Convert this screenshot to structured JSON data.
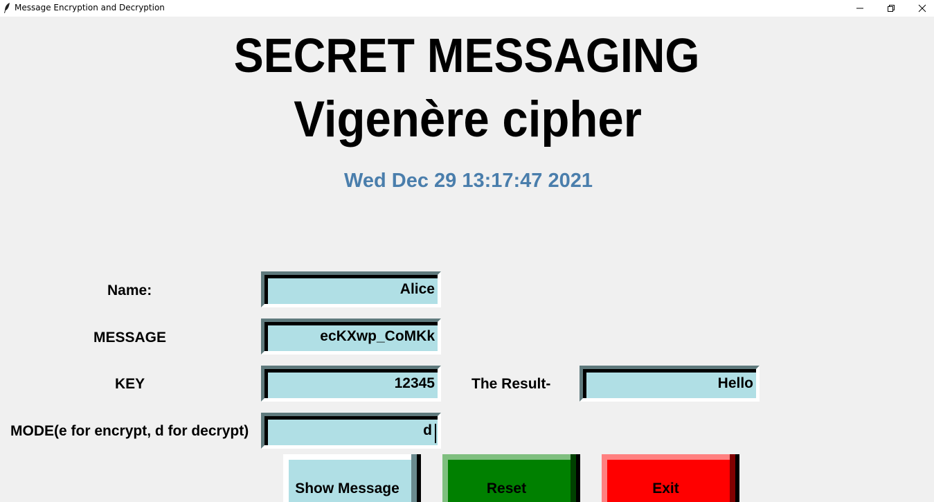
{
  "window": {
    "title": "Message Encryption and Decryption",
    "icon": "feather-icon",
    "controls": [
      "minimize-icon",
      "restore-icon",
      "close-icon"
    ]
  },
  "header": {
    "title": "SECRET MESSAGING",
    "subtitle": "Vigenère cipher",
    "datetime": "Wed Dec 29 13:17:47 2021"
  },
  "form": {
    "name_label": "Name:",
    "name_value": "Alice",
    "message_label": "MESSAGE",
    "message_value": "ecKXwp_CoMKk",
    "key_label": "KEY",
    "key_value": "12345",
    "mode_label": "MODE(e for encrypt, d for decrypt)",
    "mode_value": "d",
    "result_label": "The Result-",
    "result_value": "Hello"
  },
  "buttons": {
    "show_message": "Show Message",
    "reset": "Reset",
    "exit": "Exit"
  },
  "colors": {
    "entry_bg": "#b0dfe5",
    "datetime": "#4a7eac",
    "reset_bg": "#008000",
    "exit_bg": "#ff0000",
    "show_bg": "#b0dfe5"
  }
}
